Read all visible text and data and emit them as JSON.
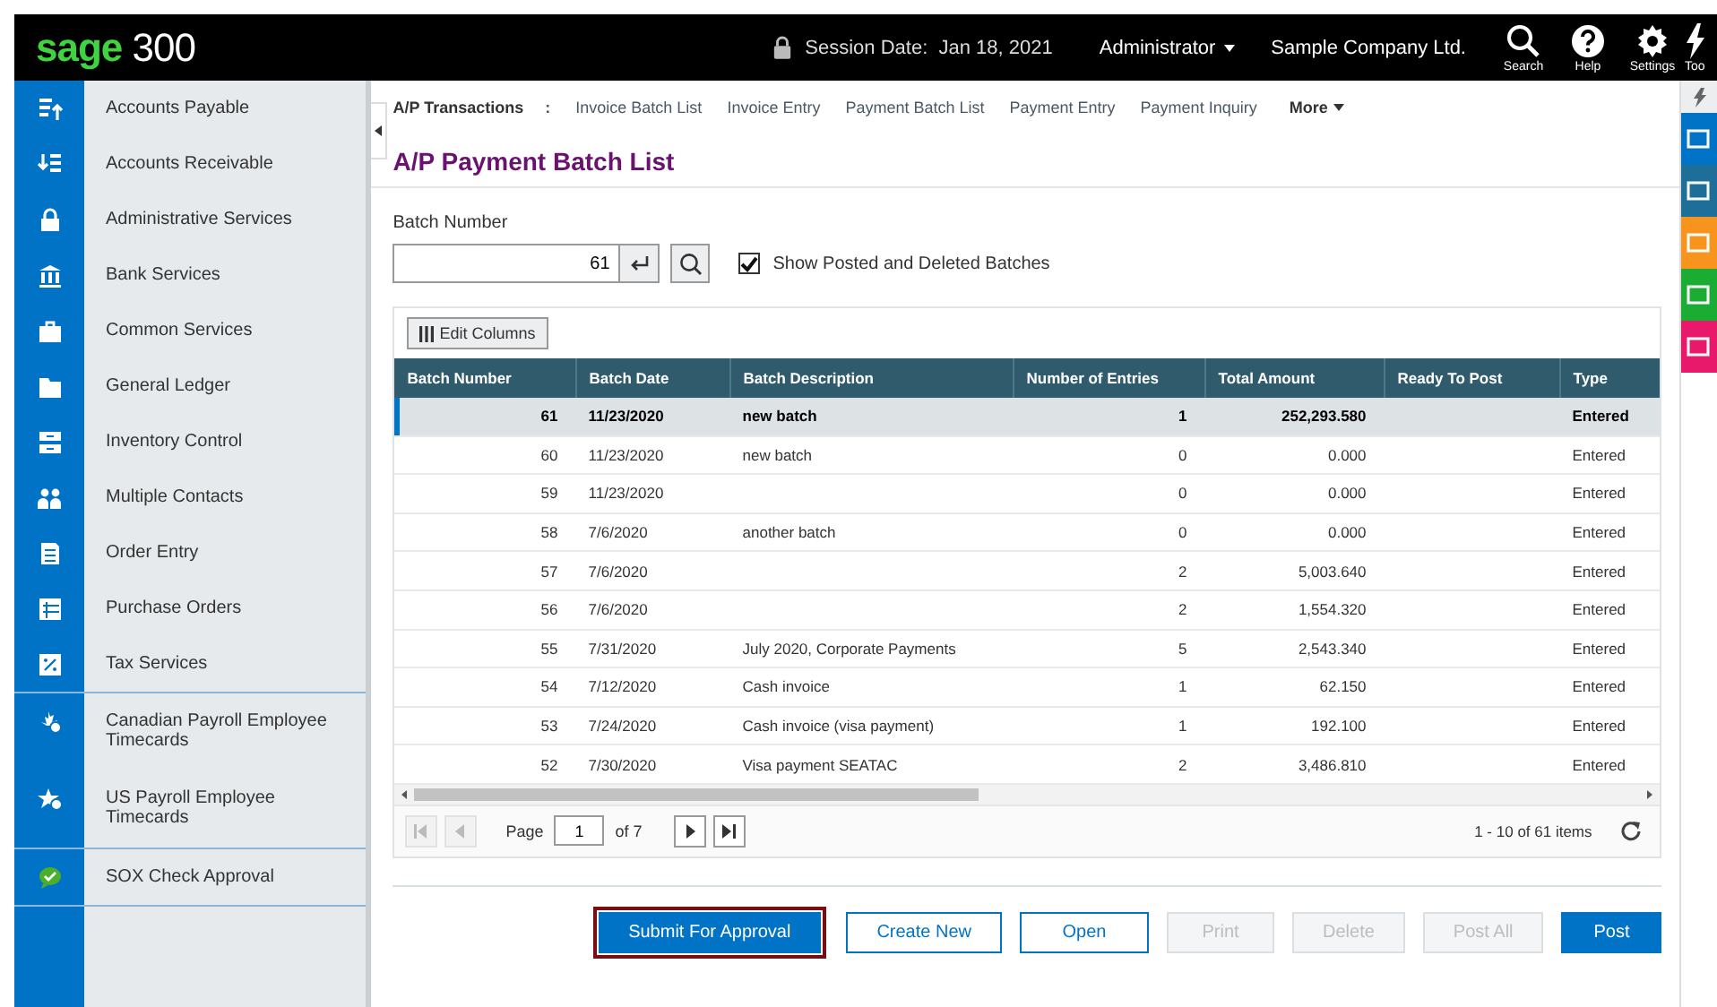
{
  "header": {
    "logo_brand": "sage",
    "logo_number": "300",
    "session_label": "Session Date:",
    "session_date": "Jan 18, 2021",
    "user": "Administrator",
    "company": "Sample Company Ltd.",
    "tools": [
      {
        "kind": "search",
        "label": "Search"
      },
      {
        "kind": "help",
        "label": "Help"
      },
      {
        "kind": "settings",
        "label": "Settings"
      },
      {
        "kind": "tools",
        "label": "Too"
      }
    ]
  },
  "sidebar": {
    "sections": [
      [
        {
          "label": "Accounts Payable"
        },
        {
          "label": "Accounts Receivable"
        },
        {
          "label": "Administrative Services"
        },
        {
          "label": "Bank Services"
        },
        {
          "label": "Common Services"
        },
        {
          "label": "General Ledger"
        },
        {
          "label": "Inventory Control"
        },
        {
          "label": "Multiple Contacts"
        },
        {
          "label": "Order Entry"
        },
        {
          "label": "Purchase Orders"
        },
        {
          "label": "Tax Services"
        }
      ],
      [
        {
          "label": "Canadian Payroll Employee Timecards"
        },
        {
          "label": "US Payroll Employee Timecards"
        }
      ],
      [
        {
          "label": "SOX Check Approval"
        }
      ]
    ]
  },
  "breadcrumb": {
    "title": "A/P Transactions",
    "separator": ":",
    "links": [
      "Invoice Batch List",
      "Invoice Entry",
      "Payment Batch List",
      "Payment Entry",
      "Payment Inquiry"
    ],
    "more": "More"
  },
  "page_title": "A/P Payment Batch List",
  "filter": {
    "label": "Batch Number",
    "value": "61",
    "checkbox_label": "Show Posted and Deleted Batches",
    "checked": true
  },
  "table": {
    "edit_columns": "Edit Columns",
    "columns": [
      "Batch Number",
      "Batch Date",
      "Batch Description",
      "Number of Entries",
      "Total Amount",
      "Ready To Post",
      "Type"
    ],
    "rows": [
      {
        "selected": true,
        "cells": [
          "61",
          "11/23/2020",
          "new batch",
          "1",
          "252,293.580",
          "",
          "Entered"
        ]
      },
      {
        "selected": false,
        "cells": [
          "60",
          "11/23/2020",
          "new batch",
          "0",
          "0.000",
          "",
          "Entered"
        ]
      },
      {
        "selected": false,
        "cells": [
          "59",
          "11/23/2020",
          "",
          "0",
          "0.000",
          "",
          "Entered"
        ]
      },
      {
        "selected": false,
        "cells": [
          "58",
          "7/6/2020",
          "another batch",
          "0",
          "0.000",
          "",
          "Entered"
        ]
      },
      {
        "selected": false,
        "cells": [
          "57",
          "7/6/2020",
          "",
          "2",
          "5,003.640",
          "",
          "Entered"
        ]
      },
      {
        "selected": false,
        "cells": [
          "56",
          "7/6/2020",
          "",
          "2",
          "1,554.320",
          "",
          "Entered"
        ]
      },
      {
        "selected": false,
        "cells": [
          "55",
          "7/31/2020",
          "July 2020, Corporate Payments",
          "5",
          "2,543.340",
          "",
          "Entered"
        ]
      },
      {
        "selected": false,
        "cells": [
          "54",
          "7/12/2020",
          "Cash invoice",
          "1",
          "62.150",
          "",
          "Entered"
        ]
      },
      {
        "selected": false,
        "cells": [
          "53",
          "7/24/2020",
          "Cash invoice (visa payment)",
          "1",
          "192.100",
          "",
          "Entered"
        ]
      },
      {
        "selected": false,
        "cells": [
          "52",
          "7/30/2020",
          "Visa payment SEATAC",
          "2",
          "3,486.810",
          "",
          "Entered"
        ]
      }
    ],
    "pager": {
      "page_label": "Page",
      "page": "1",
      "of": "of 7",
      "summary": "1 - 10 of 61 items"
    }
  },
  "buttons": [
    {
      "kind": "focused",
      "label": "Submit For Approval"
    },
    {
      "kind": "outline",
      "label": "Create New"
    },
    {
      "kind": "outline",
      "label": "Open"
    },
    {
      "kind": "disabled",
      "label": "Print"
    },
    {
      "kind": "disabled",
      "label": "Delete"
    },
    {
      "kind": "disabled",
      "label": "Post All"
    },
    {
      "kind": "primary",
      "label": "Post"
    }
  ],
  "right_tools": [
    {
      "color": "#0073c6"
    },
    {
      "color": "#1d6e98"
    },
    {
      "color": "#f7941d"
    },
    {
      "color": "#1aac33"
    },
    {
      "color": "#e8196b"
    }
  ]
}
